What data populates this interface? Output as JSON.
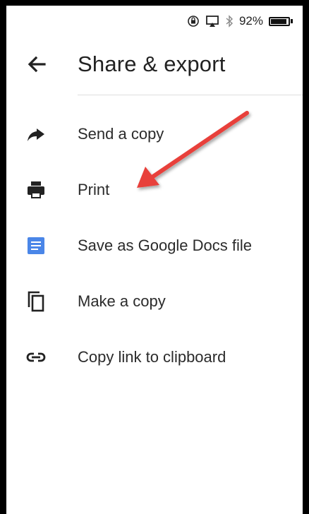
{
  "status_bar": {
    "battery_text": "92%",
    "battery_level": 0.92,
    "icons": [
      "screen-rotation-lock-icon",
      "airplay-icon",
      "bluetooth-icon",
      "battery-icon"
    ]
  },
  "header": {
    "back_icon": "arrow-left-icon",
    "title": "Share & export"
  },
  "menu": {
    "items": [
      {
        "label": "Send a copy",
        "icon": "share-arrow-icon"
      },
      {
        "label": "Print",
        "icon": "printer-icon"
      },
      {
        "label": "Save as Google Docs file",
        "icon": "google-docs-icon"
      },
      {
        "label": "Make a copy",
        "icon": "copy-icon"
      },
      {
        "label": "Copy link to clipboard",
        "icon": "link-icon"
      }
    ]
  },
  "annotation": {
    "type": "arrow",
    "color": "#e8413a",
    "points_to": "Print"
  },
  "colors": {
    "docs_blue": "#4a86e8",
    "annotation_red": "#e8413a",
    "text": "#222222"
  }
}
